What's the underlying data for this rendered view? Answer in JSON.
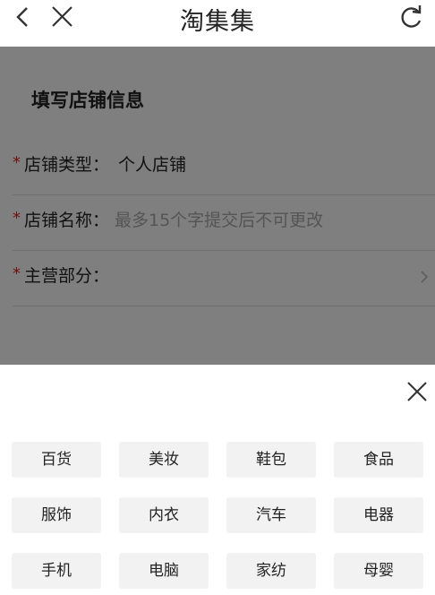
{
  "header": {
    "title": "淘集集",
    "icons": [
      "chevron-left-icon",
      "close-icon",
      "refresh-icon"
    ]
  },
  "form": {
    "section_title": "填写店铺信息",
    "required_mark": "*",
    "rows": [
      {
        "label": "店铺类型：",
        "value": "个人店铺"
      },
      {
        "label": "店铺名称：",
        "placeholder": "最多15个字提交后不可更改"
      },
      {
        "label": "主营部分："
      }
    ]
  },
  "category_sheet": {
    "categories": [
      "百货",
      "美妆",
      "鞋包",
      "食品",
      "服饰",
      "内衣",
      "汽车",
      "电器",
      "手机",
      "电脑",
      "家纺",
      "母婴"
    ]
  },
  "colors": {
    "required": "#e02020",
    "overlay": "rgba(0,0,0,0.5)",
    "chip_bg": "#f2f2f2"
  }
}
